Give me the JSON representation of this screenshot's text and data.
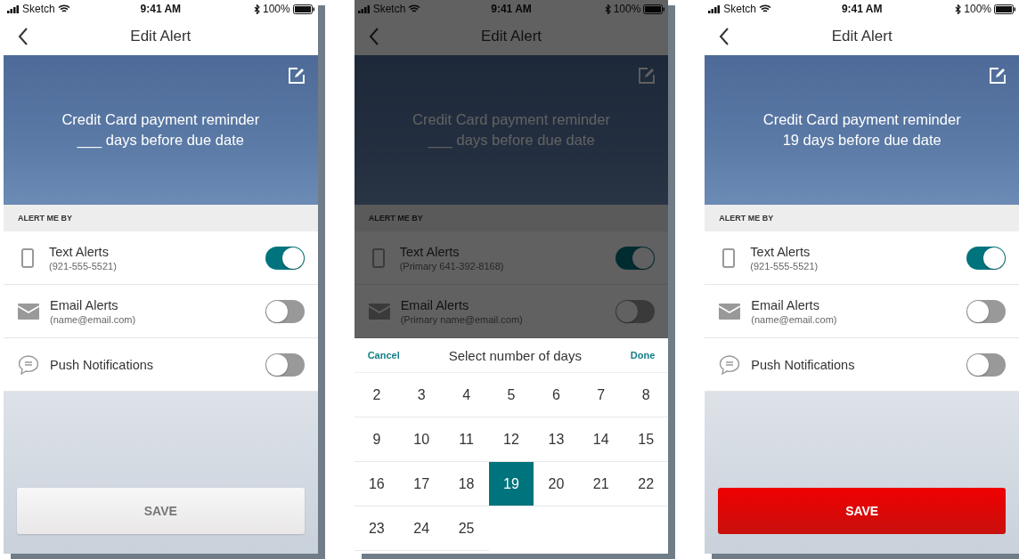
{
  "screens": [
    {
      "status_bar": {
        "carrier": "Sketch",
        "time": "9:41 AM",
        "battery": "100%"
      },
      "title": "Edit Alert",
      "dimmed": false,
      "hero": {
        "line_1": "Credit Card payment reminder",
        "line_2": "___ days before due date"
      },
      "section_label": "ALERT ME BY",
      "alerts": [
        {
          "kind": "phone",
          "label": "Text Alerts",
          "detail": "(921-555-5521)",
          "on": true
        },
        {
          "kind": "email",
          "label": "Email Alerts",
          "detail": "(name@email.com)",
          "on": false
        },
        {
          "kind": "push",
          "label": "Push Notifications",
          "on": false
        }
      ],
      "save_button": {
        "label": "SAVE",
        "enabled": false
      }
    },
    {
      "status_bar": {
        "carrier": "Sketch",
        "time": "9:41 AM",
        "battery": "100%"
      },
      "title": "Edit Alert",
      "dimmed": true,
      "hero": {
        "line_1": "Credit Card payment reminder",
        "line_2": "___ days before due date"
      },
      "section_label": "ALERT ME BY",
      "alerts": [
        {
          "kind": "phone",
          "label": "Text Alerts",
          "detail": "(Primary 641-392-8168)",
          "on": true
        },
        {
          "kind": "email",
          "label": "Email Alerts",
          "detail": "(Primary name@email.com)",
          "on": false
        }
      ],
      "picker": {
        "cancel": "Cancel",
        "title": "Select number of days",
        "done": "Done",
        "days": [
          {
            "label": "2",
            "selected": false
          },
          {
            "label": "3",
            "selected": false
          },
          {
            "label": "4",
            "selected": false
          },
          {
            "label": "5",
            "selected": false
          },
          {
            "label": "6",
            "selected": false
          },
          {
            "label": "7",
            "selected": false
          },
          {
            "label": "8",
            "selected": false
          },
          {
            "label": "9",
            "selected": false
          },
          {
            "label": "10",
            "selected": false
          },
          {
            "label": "11",
            "selected": false
          },
          {
            "label": "12",
            "selected": false
          },
          {
            "label": "13",
            "selected": false
          },
          {
            "label": "14",
            "selected": false
          },
          {
            "label": "15",
            "selected": false
          },
          {
            "label": "16",
            "selected": false
          },
          {
            "label": "17",
            "selected": false
          },
          {
            "label": "18",
            "selected": false
          },
          {
            "label": "19",
            "selected": true
          },
          {
            "label": "20",
            "selected": false
          },
          {
            "label": "21",
            "selected": false
          },
          {
            "label": "22",
            "selected": false
          },
          {
            "label": "23",
            "selected": false
          },
          {
            "label": "24",
            "selected": false
          },
          {
            "label": "25",
            "selected": false
          }
        ]
      }
    },
    {
      "status_bar": {
        "carrier": "Sketch",
        "time": "9:41 AM",
        "battery": "100%"
      },
      "title": "Edit Alert",
      "dimmed": false,
      "hero": {
        "line_1": "Credit Card payment reminder",
        "line_2": "19 days before due date"
      },
      "section_label": "ALERT ME BY",
      "alerts": [
        {
          "kind": "phone",
          "label": "Text Alerts",
          "detail": "(921-555-5521)",
          "on": true
        },
        {
          "kind": "email",
          "label": "Email Alerts",
          "detail": "(name@email.com)",
          "on": false
        },
        {
          "kind": "push",
          "label": "Push Notifications",
          "on": false
        }
      ],
      "save_button": {
        "label": "SAVE",
        "enabled": true
      }
    }
  ]
}
